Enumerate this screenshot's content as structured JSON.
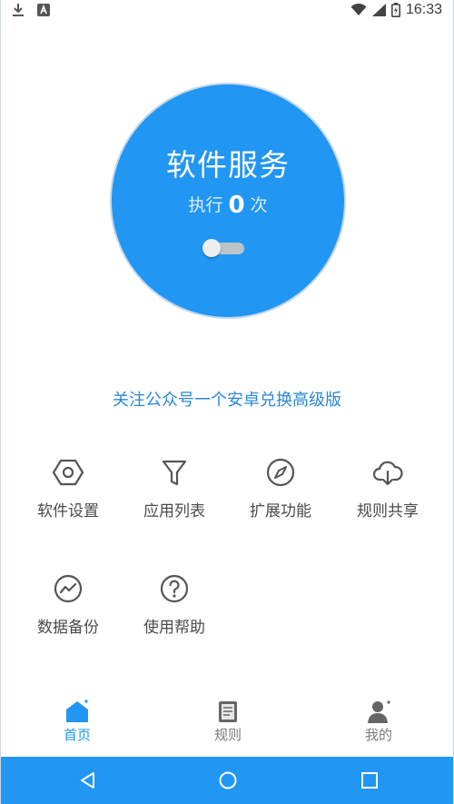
{
  "status_bar": {
    "time": "16:33",
    "left_icons": [
      "download-icon",
      "a-badge-icon"
    ],
    "right_icons": [
      "wifi-icon",
      "signal-icon",
      "battery-icon"
    ]
  },
  "service": {
    "title": "软件服务",
    "count_prefix": "执行",
    "count_value": "0",
    "count_suffix": "次",
    "toggle_on": false
  },
  "promo_text": "关注公众号一个安卓兑换高级版",
  "features": [
    {
      "label": "软件设置",
      "icon": "hexagon-settings-icon"
    },
    {
      "label": "应用列表",
      "icon": "filter-icon"
    },
    {
      "label": "扩展功能",
      "icon": "compass-icon"
    },
    {
      "label": "规则共享",
      "icon": "cloud-download-icon"
    },
    {
      "label": "数据备份",
      "icon": "trend-chart-icon"
    },
    {
      "label": "使用帮助",
      "icon": "help-icon"
    }
  ],
  "bottom_nav": [
    {
      "label": "首页",
      "icon": "home-icon",
      "active": true
    },
    {
      "label": "规则",
      "icon": "rules-icon",
      "active": false
    },
    {
      "label": "我的",
      "icon": "profile-icon",
      "active": false
    }
  ],
  "system_nav": [
    "back-icon",
    "home-circle-icon",
    "recents-icon"
  ],
  "colors": {
    "primary": "#2196f3",
    "promo_text": "#2a87d6",
    "icon_gray": "#555555"
  }
}
